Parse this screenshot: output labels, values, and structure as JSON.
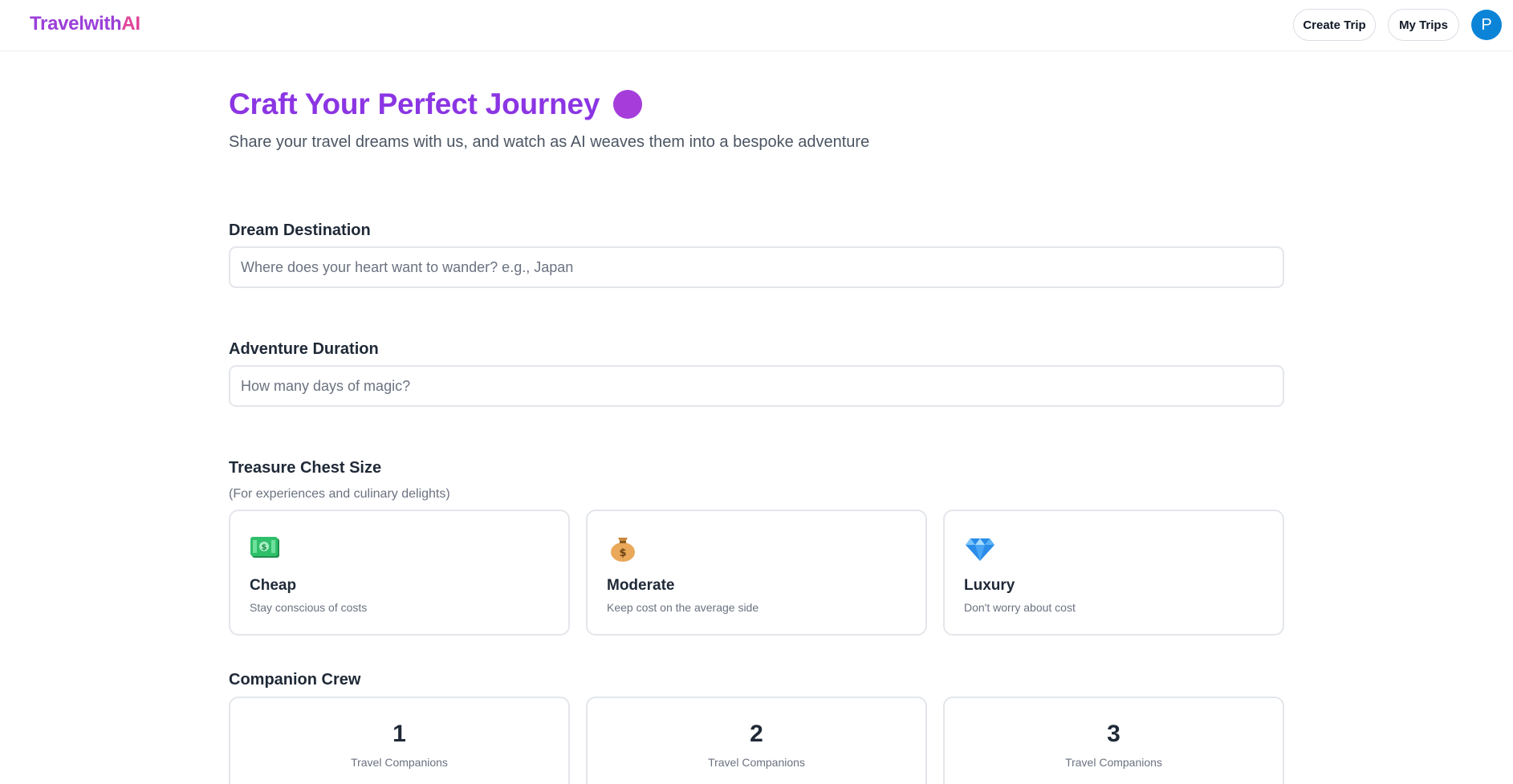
{
  "header": {
    "logo_main": "Travelwith",
    "logo_accent": "AI",
    "create_trip_label": "Create Trip",
    "my_trips_label": "My Trips",
    "avatar_initial": "P"
  },
  "hero": {
    "title": "Craft Your Perfect Journey",
    "subtitle": "Share your travel dreams with us, and watch as AI weaves them into a bespoke adventure"
  },
  "form": {
    "destination": {
      "label": "Dream Destination",
      "placeholder": "Where does your heart want to wander? e.g., Japan",
      "value": ""
    },
    "duration": {
      "label": "Adventure Duration",
      "placeholder": "How many days of magic?",
      "value": ""
    },
    "budget": {
      "label": "Treasure Chest Size",
      "hint": "(For experiences and culinary delights)",
      "options": [
        {
          "icon": "money-bills-icon",
          "title": "Cheap",
          "desc": "Stay conscious of costs"
        },
        {
          "icon": "money-bag-icon",
          "title": "Moderate",
          "desc": "Keep cost on the average side"
        },
        {
          "icon": "gem-icon",
          "title": "Luxury",
          "desc": "Don't worry about cost"
        }
      ]
    },
    "companions": {
      "label": "Companion Crew",
      "options": [
        {
          "count": "1",
          "text": "Travel Companions"
        },
        {
          "count": "2",
          "text": "Travel Companions"
        },
        {
          "count": "3",
          "text": "Travel Companions"
        }
      ]
    }
  },
  "colors": {
    "brand_purple": "#8b35e3",
    "brand_pink": "#e0449a",
    "avatar_blue": "#0b84d8"
  }
}
